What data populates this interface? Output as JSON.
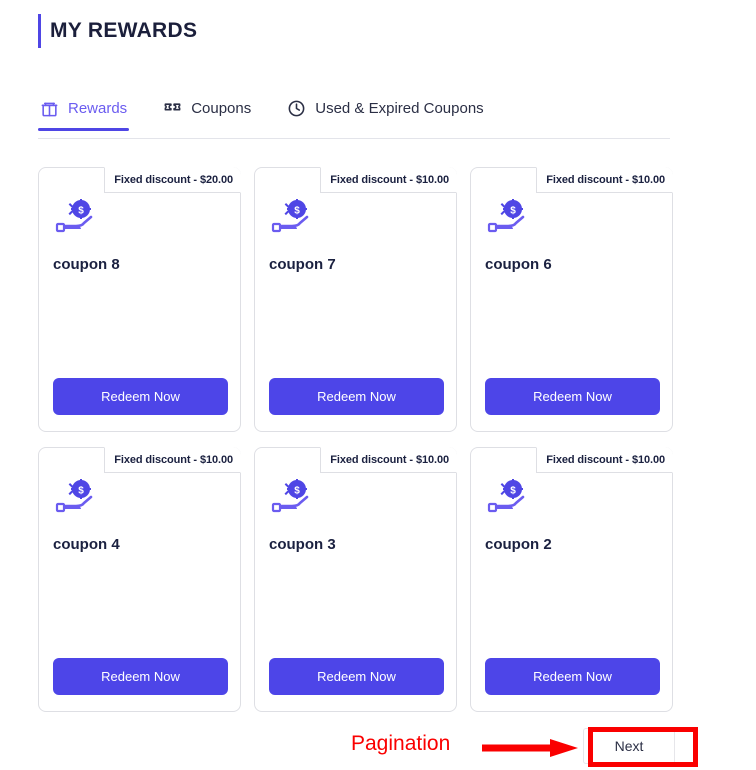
{
  "header": {
    "title": "MY REWARDS",
    "accent_color": "#4f46e5"
  },
  "tabs": [
    {
      "label": "Rewards",
      "icon": "gift-box-icon",
      "active": true
    },
    {
      "label": "Coupons",
      "icon": "ticket-icon",
      "active": false
    },
    {
      "label": "Used & Expired Coupons",
      "icon": "clock-icon",
      "active": false
    }
  ],
  "cards": [
    {
      "badge": "Fixed discount - $20.00",
      "title": "coupon 8",
      "button": "Redeem Now",
      "icon": "hand-holding-dollar-icon"
    },
    {
      "badge": "Fixed discount - $10.00",
      "title": "coupon 7",
      "button": "Redeem Now",
      "icon": "hand-holding-dollar-icon"
    },
    {
      "badge": "Fixed discount - $10.00",
      "title": "coupon 6",
      "button": "Redeem Now",
      "icon": "hand-holding-dollar-icon"
    },
    {
      "badge": "Fixed discount - $10.00",
      "title": "coupon 4",
      "button": "Redeem Now",
      "icon": "hand-holding-dollar-icon"
    },
    {
      "badge": "Fixed discount - $10.00",
      "title": "coupon 3",
      "button": "Redeem Now",
      "icon": "hand-holding-dollar-icon"
    },
    {
      "badge": "Fixed discount - $10.00",
      "title": "coupon 2",
      "button": "Redeem Now",
      "icon": "hand-holding-dollar-icon"
    }
  ],
  "pagination": {
    "next_label": "Next"
  },
  "annotation": {
    "label": "Pagination",
    "color": "#fa0000"
  },
  "colors": {
    "primary": "#4d45e8",
    "tab_active": "#6b5cf0",
    "text_dark": "#1b2140",
    "card_border": "#dedfe4",
    "annotation_red": "#fa0000"
  }
}
